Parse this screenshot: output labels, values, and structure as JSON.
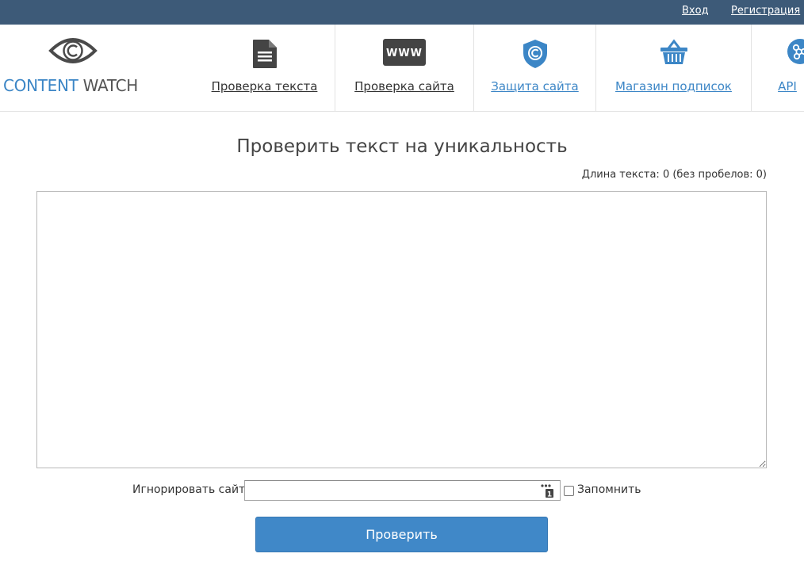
{
  "topbar": {
    "login": "Вход",
    "register": "Регистрация"
  },
  "logo": {
    "brand_first": "CONTENT",
    "brand_second": "WATCH",
    "icon": "eye-copyright-icon"
  },
  "nav": [
    {
      "label": "Проверка текста",
      "icon": "document-icon"
    },
    {
      "label": "Проверка сайта",
      "icon": "www-icon"
    },
    {
      "label": "Защита сайта",
      "icon": "shield-copyright-icon"
    },
    {
      "label": "Магазин подписок",
      "icon": "basket-icon"
    },
    {
      "label": "API",
      "icon": "share-nodes-icon"
    }
  ],
  "main": {
    "title": "Проверить текст на уникальность",
    "length_prefix": "Длина текста: ",
    "length_total": "0",
    "length_mid": " (без пробелов: ",
    "length_no_spaces": "0",
    "length_suffix": ")",
    "text_value": ""
  },
  "ignore": {
    "label": "Игнорировать сайт:",
    "value": "",
    "remember_label": "Запомнить",
    "remember_checked": false
  },
  "submit": {
    "label": "Проверить"
  },
  "colors": {
    "topbar": "#3d5a78",
    "accent": "#3c86c6",
    "button": "#4088c8",
    "dark_icon": "#444444"
  }
}
